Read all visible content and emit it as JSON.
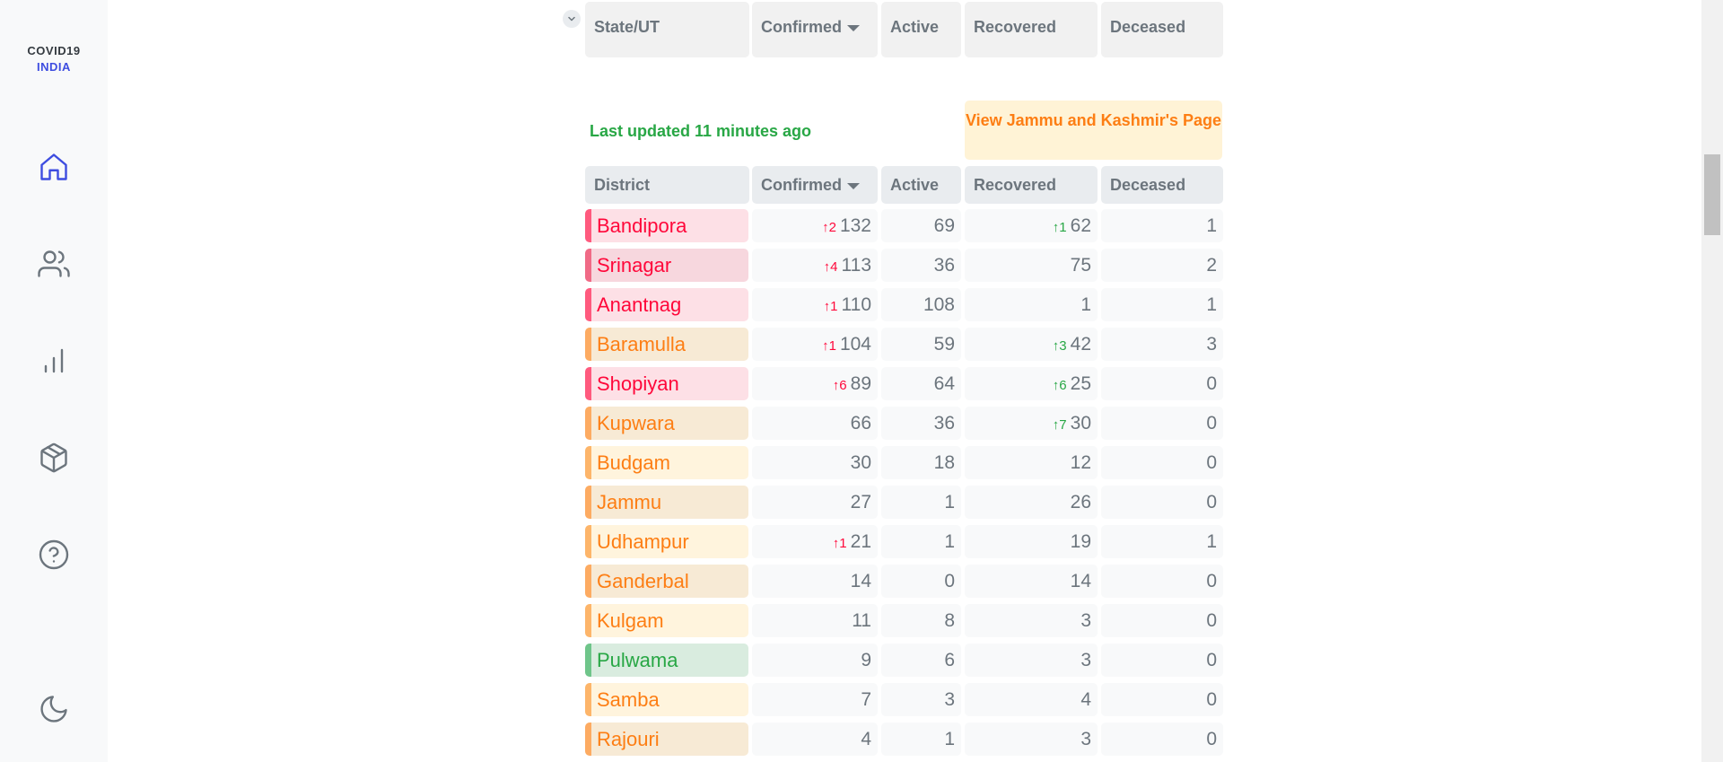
{
  "brand": {
    "line1": "COVID19",
    "line2": "INDIA"
  },
  "nav": [
    {
      "icon": "home-icon"
    },
    {
      "icon": "users-icon"
    },
    {
      "icon": "bar-chart-icon"
    },
    {
      "icon": "package-icon"
    },
    {
      "icon": "help-circle-icon"
    },
    {
      "icon": "moon-icon"
    }
  ],
  "state_table_header": {
    "state": "State/UT",
    "confirmed": "Confirmed",
    "active": "Active",
    "recovered": "Recovered",
    "deceased": "Deceased"
  },
  "last_updated": "Last updated 11 minutes ago",
  "view_page_button": "View Jammu and Kashmir's Page",
  "district_table_header": {
    "district": "District",
    "confirmed": "Confirmed",
    "active": "Active",
    "recovered": "Recovered",
    "deceased": "Deceased"
  },
  "districts": [
    {
      "name": "Bandipora",
      "confirmed_delta": "2",
      "confirmed": "132",
      "active": "69",
      "recovered_delta": "1",
      "recovered": "62",
      "deceased": "1"
    },
    {
      "name": "Srinagar",
      "confirmed_delta": "4",
      "confirmed": "113",
      "active": "36",
      "recovered_delta": "",
      "recovered": "75",
      "deceased": "2"
    },
    {
      "name": "Anantnag",
      "confirmed_delta": "1",
      "confirmed": "110",
      "active": "108",
      "recovered_delta": "",
      "recovered": "1",
      "deceased": "1"
    },
    {
      "name": "Baramulla",
      "confirmed_delta": "1",
      "confirmed": "104",
      "active": "59",
      "recovered_delta": "3",
      "recovered": "42",
      "deceased": "3"
    },
    {
      "name": "Shopiyan",
      "confirmed_delta": "6",
      "confirmed": "89",
      "active": "64",
      "recovered_delta": "6",
      "recovered": "25",
      "deceased": "0"
    },
    {
      "name": "Kupwara",
      "confirmed_delta": "",
      "confirmed": "66",
      "active": "36",
      "recovered_delta": "7",
      "recovered": "30",
      "deceased": "0"
    },
    {
      "name": "Budgam",
      "confirmed_delta": "",
      "confirmed": "30",
      "active": "18",
      "recovered_delta": "",
      "recovered": "12",
      "deceased": "0"
    },
    {
      "name": "Jammu",
      "confirmed_delta": "",
      "confirmed": "27",
      "active": "1",
      "recovered_delta": "",
      "recovered": "26",
      "deceased": "0"
    },
    {
      "name": "Udhampur",
      "confirmed_delta": "1",
      "confirmed": "21",
      "active": "1",
      "recovered_delta": "",
      "recovered": "19",
      "deceased": "1"
    },
    {
      "name": "Ganderbal",
      "confirmed_delta": "",
      "confirmed": "14",
      "active": "0",
      "recovered_delta": "",
      "recovered": "14",
      "deceased": "0"
    },
    {
      "name": "Kulgam",
      "confirmed_delta": "",
      "confirmed": "11",
      "active": "8",
      "recovered_delta": "",
      "recovered": "3",
      "deceased": "0"
    },
    {
      "name": "Pulwama",
      "confirmed_delta": "",
      "confirmed": "9",
      "active": "6",
      "recovered_delta": "",
      "recovered": "3",
      "deceased": "0"
    },
    {
      "name": "Samba",
      "confirmed_delta": "",
      "confirmed": "7",
      "active": "3",
      "recovered_delta": "",
      "recovered": "4",
      "deceased": "0"
    },
    {
      "name": "Rajouri",
      "confirmed_delta": "",
      "confirmed": "4",
      "active": "1",
      "recovered_delta": "",
      "recovered": "3",
      "deceased": "0"
    }
  ],
  "colors": {
    "confirmed_red": "#ff073a",
    "recovered_green": "#28a745",
    "orange": "#fd7e14",
    "brand_blue": "#3e4de0"
  }
}
